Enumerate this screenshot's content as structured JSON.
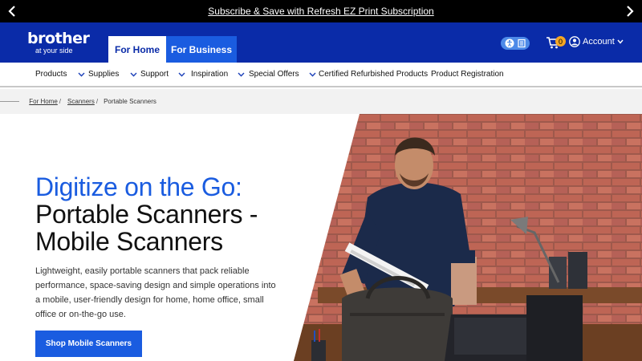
{
  "promo": {
    "text": "Subscribe & Save with Refresh EZ Print Subscription"
  },
  "header": {
    "logo_brand": "brother",
    "logo_tagline": "at your side",
    "tabs": [
      {
        "label": "For Home",
        "active": true
      },
      {
        "label": "For Business",
        "active": false
      }
    ],
    "cart_count": "0",
    "account_label": "Account"
  },
  "nav": {
    "items": [
      {
        "label": "Products",
        "has_dropdown": true
      },
      {
        "label": "Supplies",
        "has_dropdown": true
      },
      {
        "label": "Support",
        "has_dropdown": true
      },
      {
        "label": "Inspiration",
        "has_dropdown": true
      },
      {
        "label": "Special Offers",
        "has_dropdown": true
      },
      {
        "label": "Certified Refurbished Products",
        "has_dropdown": false
      },
      {
        "label": "Product Registration",
        "has_dropdown": false
      }
    ]
  },
  "breadcrumb": {
    "items": [
      "For Home",
      "Scanners",
      "Portable Scanners"
    ]
  },
  "hero": {
    "title_accent": "Digitize on the Go:",
    "title_line2": "Portable Scanners -",
    "title_line3": "Mobile Scanners",
    "description": "Lightweight, easily portable scanners that pack reliable performance, space-saving design and simple operations into a mobile, user-friendly design for home, home office, small office or on-the-go use.",
    "cta_label": "Shop Mobile Scanners"
  },
  "colors": {
    "brand_blue": "#0a2ba8",
    "accent_blue": "#1a5ce0",
    "badge": "#f5a623"
  },
  "icons": [
    "chevron-left-icon",
    "chevron-right-icon",
    "accessibility-icon",
    "cart-icon",
    "user-icon",
    "chevron-down-icon"
  ]
}
